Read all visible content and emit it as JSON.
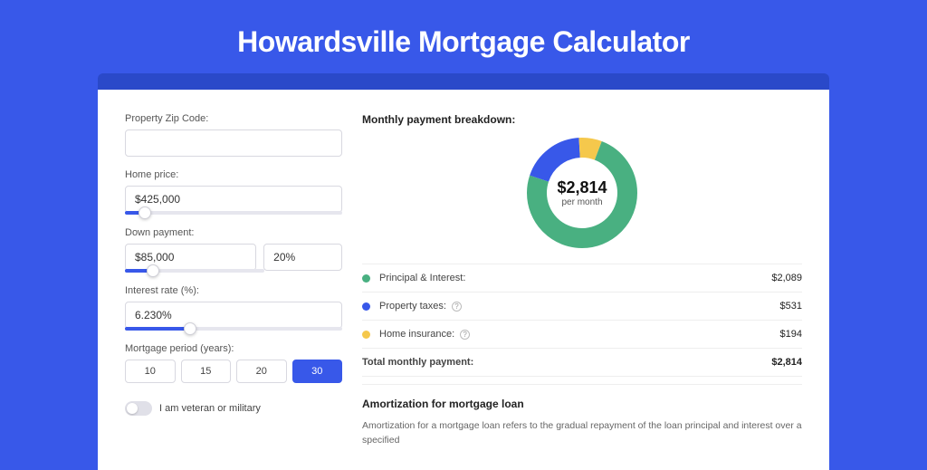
{
  "title": "Howardsville Mortgage Calculator",
  "form": {
    "zip_label": "Property Zip Code:",
    "zip_value": "",
    "home_price_label": "Home price:",
    "home_price_value": "$425,000",
    "home_price_slider_pct": 9,
    "down_payment_label": "Down payment:",
    "down_payment_value": "$85,000",
    "down_payment_pct_value": "20%",
    "down_payment_slider_pct": 20,
    "interest_label": "Interest rate (%):",
    "interest_value": "6.230%",
    "interest_slider_pct": 30,
    "period_label": "Mortgage period (years):",
    "periods": [
      "10",
      "15",
      "20",
      "30"
    ],
    "period_active_index": 3,
    "veteran_label": "I am veteran or military",
    "veteran_on": false
  },
  "breakdown": {
    "title": "Monthly payment breakdown:",
    "amount": "$2,814",
    "sub": "per month",
    "items": [
      {
        "label": "Principal & Interest:",
        "value": "$2,089",
        "color": "#49b081",
        "has_info": false,
        "fraction": 0.742
      },
      {
        "label": "Property taxes:",
        "value": "$531",
        "color": "#3858e9",
        "has_info": true,
        "fraction": 0.189
      },
      {
        "label": "Home insurance:",
        "value": "$194",
        "color": "#f5c84c",
        "has_info": true,
        "fraction": 0.069
      }
    ],
    "total_label": "Total monthly payment:",
    "total_value": "$2,814"
  },
  "amort": {
    "title": "Amortization for mortgage loan",
    "text": "Amortization for a mortgage loan refers to the gradual repayment of the loan principal and interest over a specified"
  },
  "chart_data": {
    "type": "pie",
    "title": "Monthly payment breakdown",
    "categories": [
      "Principal & Interest",
      "Property taxes",
      "Home insurance"
    ],
    "values": [
      2089,
      531,
      194
    ],
    "colors": [
      "#49b081",
      "#3858e9",
      "#f5c84c"
    ],
    "center_label": "$2,814 per month"
  }
}
